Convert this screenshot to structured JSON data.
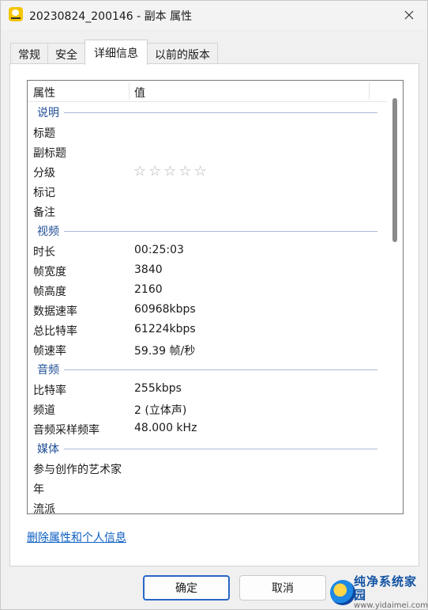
{
  "window": {
    "title": "20230824_200146 - 副本 属性",
    "close_icon": "close-icon"
  },
  "tabs": [
    {
      "label": "常规",
      "active": false
    },
    {
      "label": "安全",
      "active": false
    },
    {
      "label": "详细信息",
      "active": true
    },
    {
      "label": "以前的版本",
      "active": false
    }
  ],
  "list": {
    "header": {
      "name": "属性",
      "value": "值"
    },
    "groups": [
      {
        "label": "说明",
        "rows": [
          {
            "name": "标题",
            "value": ""
          },
          {
            "name": "副标题",
            "value": ""
          },
          {
            "name": "分级",
            "value": "",
            "rating": 0,
            "max": 5
          },
          {
            "name": "标记",
            "value": ""
          },
          {
            "name": "备注",
            "value": ""
          }
        ]
      },
      {
        "label": "视频",
        "rows": [
          {
            "name": "时长",
            "value": "00:25:03"
          },
          {
            "name": "帧宽度",
            "value": "3840"
          },
          {
            "name": "帧高度",
            "value": "2160"
          },
          {
            "name": "数据速率",
            "value": "60968kbps"
          },
          {
            "name": "总比特率",
            "value": "61224kbps"
          },
          {
            "name": "帧速率",
            "value": "59.39 帧/秒"
          }
        ]
      },
      {
        "label": "音频",
        "rows": [
          {
            "name": "比特率",
            "value": "255kbps"
          },
          {
            "name": "频道",
            "value": "2 (立体声)"
          },
          {
            "name": "音频采样频率",
            "value": "48.000 kHz"
          }
        ]
      },
      {
        "label": "媒体",
        "rows": [
          {
            "name": "参与创作的艺术家",
            "value": ""
          },
          {
            "name": "年",
            "value": ""
          },
          {
            "name": "流派",
            "value": ""
          }
        ]
      }
    ]
  },
  "link": {
    "label": "删除属性和个人信息"
  },
  "buttons": {
    "ok": "确定",
    "cancel": "取消"
  },
  "watermark": {
    "title": "纯净系统家园",
    "url": "www.yidaimei.com"
  },
  "colors": {
    "accent": "#2a66c8",
    "group_label": "#1f4e96",
    "link": "#0a5ec2"
  }
}
